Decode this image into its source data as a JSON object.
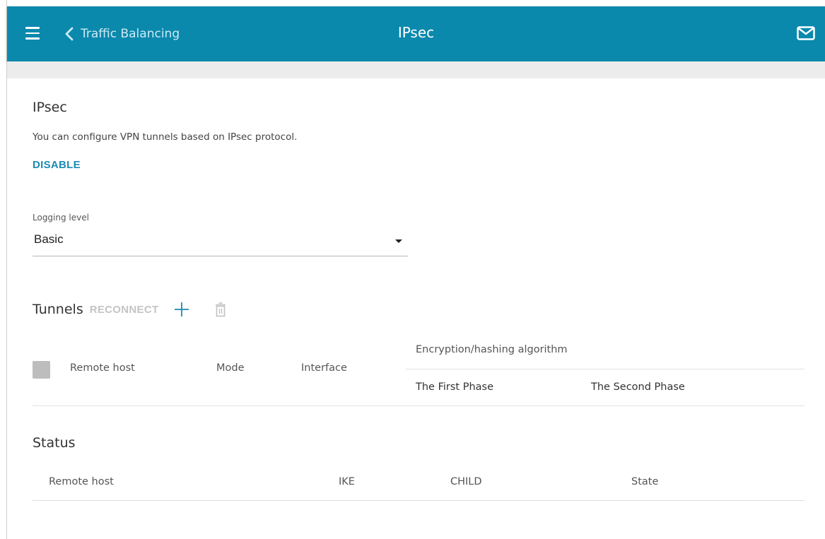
{
  "header": {
    "back_label": "Traffic Balancing",
    "title": "IPsec",
    "color": "#0a89ad"
  },
  "ipsec": {
    "heading": "IPsec",
    "description": "You can configure VPN tunnels based on IPsec protocol.",
    "disable_label": "DISABLE"
  },
  "logging": {
    "label": "Logging level",
    "value": "Basic"
  },
  "tunnels": {
    "heading": "Tunnels",
    "reconnect_label": "RECONNECT",
    "columns": {
      "remote_host": "Remote host",
      "mode": "Mode",
      "interface": "Interface",
      "algorithm": "Encryption/hashing algorithm",
      "first_phase": "The First Phase",
      "second_phase": "The Second Phase"
    }
  },
  "status": {
    "heading": "Status",
    "columns": [
      "Remote host",
      "IKE",
      "CHILD",
      "State"
    ]
  },
  "icons": {
    "menu": "hamburger-icon",
    "back": "chevron-left-icon",
    "mail": "mail-icon",
    "add": "plus-icon",
    "delete": "trash-icon",
    "dropdown": "caret-down-icon"
  }
}
